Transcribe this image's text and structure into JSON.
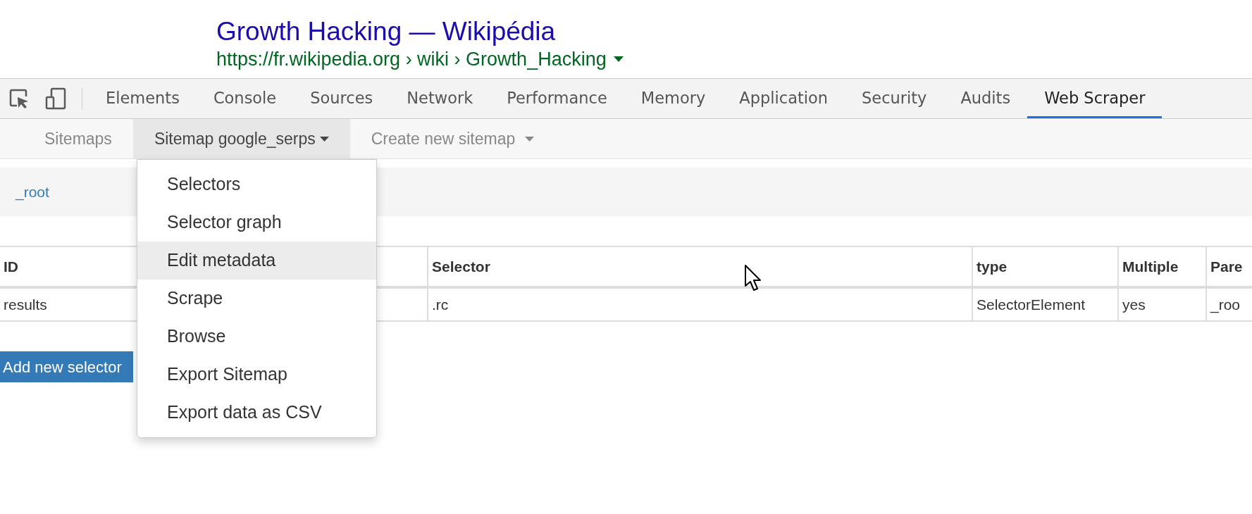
{
  "search_result": {
    "title": "Growth Hacking — Wikipédia",
    "url": "https://fr.wikipedia.org › wiki › Growth_Hacking"
  },
  "devtools": {
    "tabs": [
      {
        "label": "Elements",
        "selected": false
      },
      {
        "label": "Console",
        "selected": false
      },
      {
        "label": "Sources",
        "selected": false
      },
      {
        "label": "Network",
        "selected": false
      },
      {
        "label": "Performance",
        "selected": false
      },
      {
        "label": "Memory",
        "selected": false
      },
      {
        "label": "Application",
        "selected": false
      },
      {
        "label": "Security",
        "selected": false
      },
      {
        "label": "Audits",
        "selected": false
      },
      {
        "label": "Web Scraper",
        "selected": true
      }
    ]
  },
  "scraper_nav": {
    "items": [
      {
        "label": "Sitemaps",
        "selected": false,
        "kind": "link"
      },
      {
        "label": "Sitemap google_serps",
        "selected": true,
        "kind": "dropdown"
      },
      {
        "label": "Create new sitemap",
        "selected": false,
        "kind": "dropdown"
      }
    ]
  },
  "breadcrumb": [
    "_root"
  ],
  "table": {
    "columns": [
      "ID",
      "Selector",
      "type",
      "Multiple",
      "Pare"
    ],
    "rows": [
      [
        "results",
        ".rc",
        "SelectorElement",
        "yes",
        "_roo"
      ]
    ]
  },
  "add_button": "Add new selector",
  "menu": {
    "items": [
      {
        "label": "Selectors",
        "highlighted": false
      },
      {
        "label": "Selector graph",
        "highlighted": false
      },
      {
        "label": "Edit metadata",
        "highlighted": true
      },
      {
        "label": "Scrape",
        "highlighted": false
      },
      {
        "label": "Browse",
        "highlighted": false
      },
      {
        "label": "Export Sitemap",
        "highlighted": false
      },
      {
        "label": "Export data as CSV",
        "highlighted": false
      }
    ]
  }
}
